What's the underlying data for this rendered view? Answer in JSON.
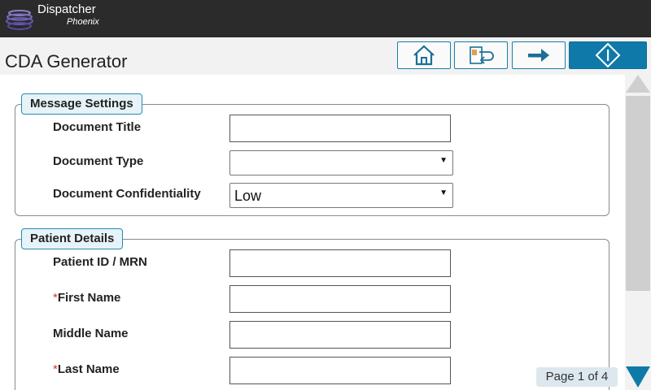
{
  "brand": {
    "name": "Dispatcher",
    "sub": "Phoenix"
  },
  "page": {
    "title": "CDA Generator"
  },
  "toolbar": [
    {
      "name": "home-button",
      "icon": "home-icon"
    },
    {
      "name": "return-button",
      "icon": "document-return-icon"
    },
    {
      "name": "next-button",
      "icon": "arrow-right-icon"
    },
    {
      "name": "start-button",
      "icon": "diamond-start-icon"
    }
  ],
  "message_settings": {
    "legend": "Message Settings",
    "document_title": {
      "label": "Document Title",
      "value": ""
    },
    "document_type": {
      "label": "Document Type",
      "value": ""
    },
    "confidentiality": {
      "label": "Document Confidentiality",
      "value": "Low"
    }
  },
  "patient_details": {
    "legend": "Patient Details",
    "patient_id": {
      "label": "Patient ID / MRN",
      "value": ""
    },
    "first_name": {
      "label": "First Name",
      "required_mark": "*",
      "value": ""
    },
    "middle_name": {
      "label": "Middle Name",
      "value": ""
    },
    "last_name": {
      "label": "Last Name",
      "required_mark": "*",
      "value": ""
    }
  },
  "pagination": {
    "text": "Page 1 of 4"
  },
  "colors": {
    "accent": "#0f7aa9",
    "header": "#2b2b2b",
    "required": "#d33"
  }
}
